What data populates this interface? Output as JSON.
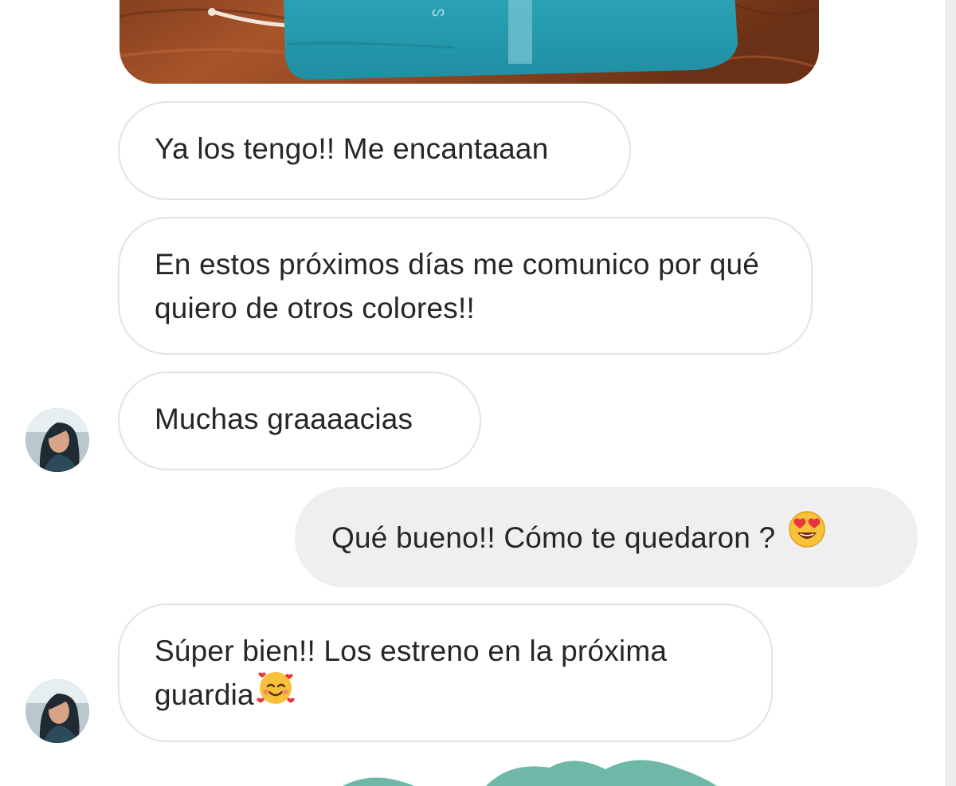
{
  "image_attachment": {
    "description_icon": "shared-photo-teal-garment"
  },
  "messages": [
    {
      "direction": "incoming",
      "text": "Ya los tengo!! Me encantaaan"
    },
    {
      "direction": "incoming",
      "text": "En estos próximos días me comunico por qué quiero de otros colores!!"
    },
    {
      "direction": "incoming",
      "text": "Muchas graaaacias"
    },
    {
      "direction": "outgoing",
      "text": "Qué bueno!! Cómo te quedaron ?",
      "emoji": "heart-eyes-emoji"
    },
    {
      "direction": "incoming",
      "text": "Súper bien!! Los estreno en la próxima guardia",
      "emoji": "smiling-face-with-hearts-emoji"
    }
  ],
  "colors": {
    "incoming_bubble_bg": "#ffffff",
    "incoming_bubble_border": "#e3e3e3",
    "outgoing_bubble_bg": "#efefef",
    "text": "#262626",
    "teal_garment": "#2a9db0",
    "accent_shape": "#6fb7a6"
  }
}
